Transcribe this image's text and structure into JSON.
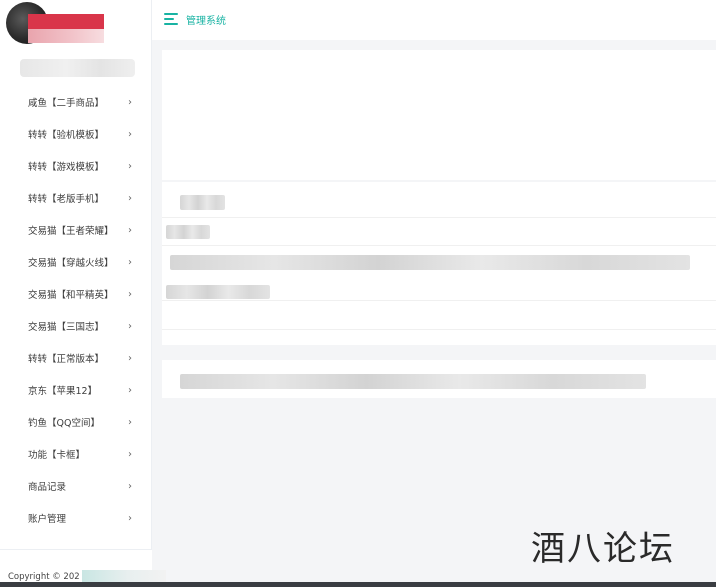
{
  "header": {
    "site_title": "管理系统",
    "menu_icon": "hamburger-menu-icon"
  },
  "sidebar": {
    "items": [
      {
        "label": "咸鱼【二手商品】"
      },
      {
        "label": "转转【验机模板】"
      },
      {
        "label": "转转【游戏模板】"
      },
      {
        "label": "转转【老版手机】"
      },
      {
        "label": "交易猫【王者荣耀】"
      },
      {
        "label": "交易猫【穿越火线】"
      },
      {
        "label": "交易猫【和平精英】"
      },
      {
        "label": "交易猫【三国志】"
      },
      {
        "label": "转转【正常版本】"
      },
      {
        "label": "京东【苹果12】"
      },
      {
        "label": "钓鱼【QQ空间】"
      },
      {
        "label": "功能【卡框】"
      },
      {
        "label": "商品记录"
      },
      {
        "label": "账户管理"
      }
    ],
    "chevron": "›",
    "footer": {
      "copyright": "Copyright © 202"
    }
  },
  "watermark": {
    "text": "酒八论坛"
  },
  "colors": {
    "accent": "#18b3a3",
    "background": "#f4f5f7",
    "brand_red": "#d9354a"
  }
}
